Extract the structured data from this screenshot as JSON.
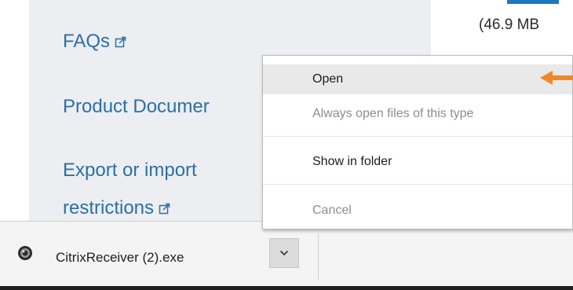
{
  "sidebar": {
    "links": [
      {
        "label": "FAQs"
      },
      {
        "label": "Product Documer"
      },
      {
        "label": "Export or import"
      },
      {
        "label": "restrictions"
      }
    ]
  },
  "download_info": {
    "size_text": "(46.9 MB"
  },
  "context_menu": {
    "items": [
      {
        "label": "Open",
        "state": "hovered"
      },
      {
        "label": "Always open files of this type",
        "state": "disabled"
      },
      {
        "label": "Show in folder",
        "state": "enabled"
      },
      {
        "label": "Cancel",
        "state": "disabled"
      }
    ]
  },
  "download_bar": {
    "file_name": "CitrixReceiver (2).exe",
    "file_icon": "citrix-receiver-icon",
    "menu_toggle_icon": "chevron-down-icon"
  },
  "colors": {
    "link": "#2d6fa6",
    "annotation_arrow": "#f0882a",
    "menu_hover": "#e9e9e9"
  }
}
